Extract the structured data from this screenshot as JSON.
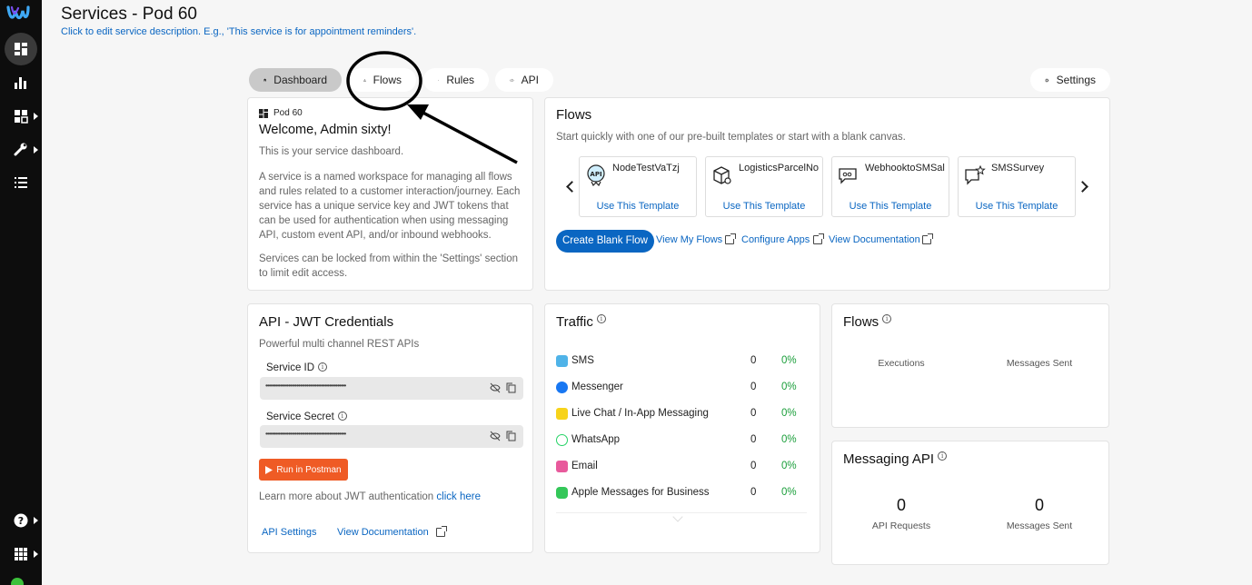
{
  "header": {
    "title": "Services - Pod 60",
    "subtitle": "Click to edit service description. E.g., 'This service is for appointment reminders'."
  },
  "rail": {
    "items": [
      "dashboard-icon",
      "analytics-icon",
      "apps-icon",
      "tools-icon",
      "list-icon",
      "help-icon",
      "grid-icon"
    ]
  },
  "tabs": [
    {
      "label": "Dashboard",
      "icon": "home-icon"
    },
    {
      "label": "Flows",
      "icon": "flows-icon"
    },
    {
      "label": "Rules",
      "icon": "shuffle-icon"
    },
    {
      "label": "API",
      "icon": "code-icon"
    }
  ],
  "settings_label": "Settings",
  "welcome": {
    "pod": "Pod 60",
    "heading": "Welcome, Admin sixty!",
    "intro": "This is your service dashboard.",
    "p1": "A service is a named workspace for managing all flows and rules related to a customer interaction/journey. Each service has a unique service key and JWT tokens that can be used for authentication when using messaging API, custom event API, and/or inbound webhooks.",
    "p2": "Services can be locked from within the 'Settings' section to limit edit access."
  },
  "flows_card": {
    "heading": "Flows",
    "description": "Start quickly with one of our pre-built templates or start with a blank canvas.",
    "templates": [
      {
        "name": "NodeTestVaTzj",
        "action": "Use This Template",
        "icon": "api-bot-icon"
      },
      {
        "name": "LogisticsParcelNo",
        "action": "Use This Template",
        "icon": "parcel-icon"
      },
      {
        "name": "WebhooktoSMSal",
        "action": "Use This Template",
        "icon": "webhook-chat-icon"
      },
      {
        "name": "SMSSurvey",
        "action": "Use This Template",
        "icon": "survey-icon"
      }
    ],
    "create_blank": "Create Blank Flow",
    "view_my_flows": "View My Flows",
    "configure_apps": "Configure Apps",
    "view_documentation": "View Documentation"
  },
  "jwt": {
    "heading": "API - JWT Credentials",
    "description": "Powerful multi channel REST APIs",
    "service_id_label": "Service ID",
    "service_id_value": "•••••••••••••••••••••••••••••••••••••••••••••••••",
    "service_secret_label": "Service Secret",
    "service_secret_value": "•••••••••••••••••••••••••••••••••••••••••••••••••",
    "postman": "Run in Postman",
    "learn_more": "Learn more about JWT authentication",
    "click_here": "click here",
    "api_settings": "API Settings",
    "view_documentation": "View Documentation"
  },
  "traffic": {
    "heading": "Traffic",
    "rows": [
      {
        "label": "SMS",
        "count": "0",
        "pct": "0%",
        "color": "#4fb3e8"
      },
      {
        "label": "Messenger",
        "count": "0",
        "pct": "0%",
        "color": "#1877f2"
      },
      {
        "label": "Live Chat / In-App Messaging",
        "count": "0",
        "pct": "0%",
        "color": "#f7d31a"
      },
      {
        "label": "WhatsApp",
        "count": "0",
        "pct": "0%",
        "color": "#25d366"
      },
      {
        "label": "Email",
        "count": "0",
        "pct": "0%",
        "color": "#e85a9c"
      },
      {
        "label": "Apple Messages for Business",
        "count": "0",
        "pct": "0%",
        "color": "#34c759"
      }
    ]
  },
  "flows_stats": {
    "heading": "Flows",
    "executions": "Executions",
    "messages_sent": "Messages Sent"
  },
  "messaging_api": {
    "heading": "Messaging API",
    "api_requests_value": "0",
    "api_requests": "API Requests",
    "messages_sent_value": "0",
    "messages_sent": "Messages Sent"
  }
}
